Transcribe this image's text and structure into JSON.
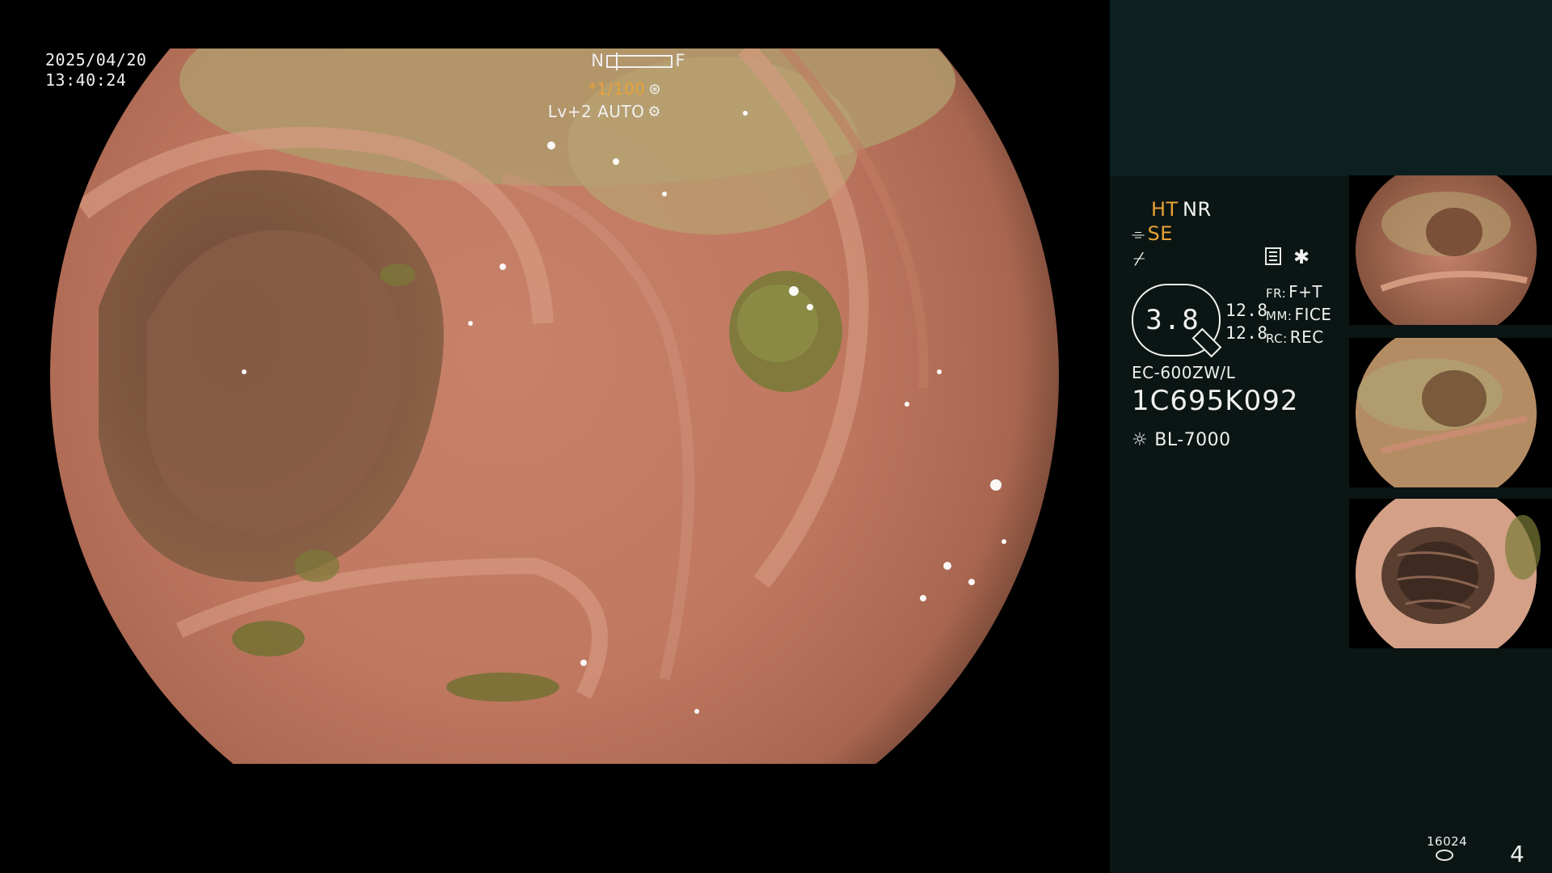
{
  "main_view": {
    "date": "2025/04/20",
    "time": "13:40:24",
    "focus_near": "N",
    "focus_far": "F",
    "shutter": "*1/100",
    "iris": "Lv+2 AUTO"
  },
  "info_panel": {
    "ht": "HT",
    "nr": "NR",
    "se": "SE",
    "zoom": "3.8",
    "fr_value_1": "12.8",
    "fr_value_2": "12.8",
    "params": [
      {
        "key": "FR:",
        "value": "F+T"
      },
      {
        "key": "MM:",
        "value": "FICE"
      },
      {
        "key": "RC:",
        "value": "REC"
      }
    ],
    "scope_model": "EC-600ZW/L",
    "scope_serial": "1C695K092",
    "light_source": "BL-7000",
    "record_count": "16024",
    "page_number": "4"
  },
  "colors": {
    "panel_top": "#0c2020",
    "panel": "#0b1514",
    "accent_orange": "#e8a238",
    "text": "#f0f0f0"
  },
  "icons": [
    "asterisk-icon",
    "scope-tool-icon",
    "flash-icon",
    "memo-icon",
    "light-source-icon",
    "database-icon"
  ]
}
